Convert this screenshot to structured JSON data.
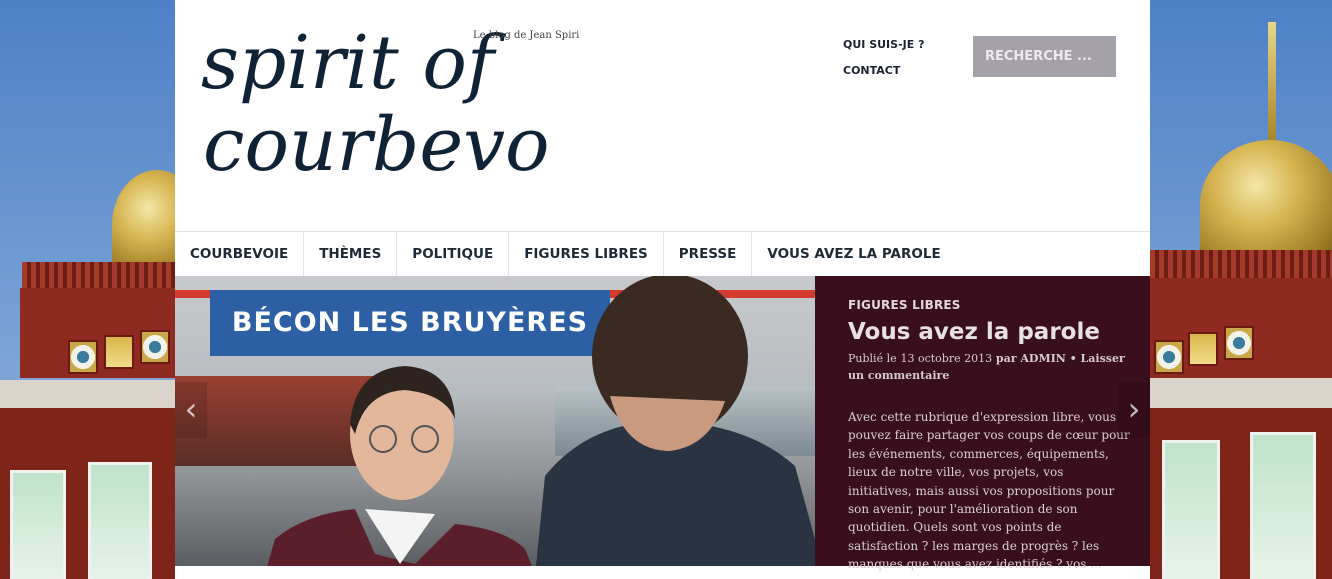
{
  "site": {
    "logo_text_line1": "spirit of",
    "logo_text_line2": "courbevoie",
    "tagline": "Le blog de Jean Spiri"
  },
  "top_links": [
    "QUI SUIS-JE ?",
    "CONTACT"
  ],
  "search": {
    "placeholder": "RECHERCHE ..."
  },
  "nav": [
    "COURBEVOIE",
    "THÈMES",
    "POLITIQUE",
    "FIGURES LIBRES",
    "PRESSE",
    "VOUS AVEZ LA PAROLE"
  ],
  "slider": {
    "photo_sign": "BÉCON LES BRUYÈRES",
    "category": "FIGURES LIBRES",
    "title": "Vous avez la parole",
    "meta_prefix": "Publié le",
    "meta_date": "13 octobre 2013",
    "meta_by": "par",
    "meta_author": "ADMIN",
    "meta_comment": "• Laisser un commentaire",
    "excerpt": "Avec cette rubrique d'expression libre, vous pouvez faire partager vos coups de cœur pour les événements, commerces, équipements, lieux de notre ville, vos projets, vos initiatives, mais aussi vos propositions pour son avenir, pour l'amélioration de son quotidien. Quels sont vos points de satisfaction ? les marges de progrès ? les manques que vous avez identifiés ? vos ...",
    "prev_icon": "chevron-left-icon",
    "next_icon": "chevron-right-icon"
  },
  "colors": {
    "caption_bg": "#3a0f1d",
    "search_bg": "#a5a1a9",
    "logo_color": "#0f2236"
  }
}
